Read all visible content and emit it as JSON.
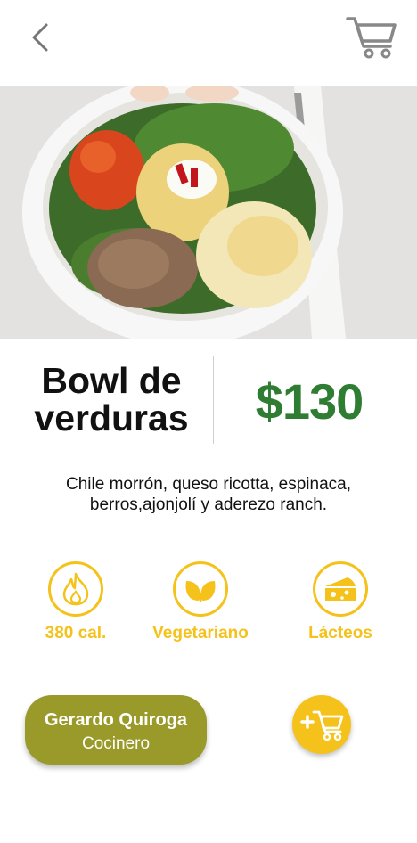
{
  "header": {
    "back_icon": "chevron-left-icon",
    "cart_icon": "cart-icon"
  },
  "dish": {
    "name": "Bowl de verduras",
    "price": "$130",
    "description": "Chile morrón, queso ricotta, espinaca, berros,ajonjolí y aderezo ranch."
  },
  "attributes": [
    {
      "icon": "flame-icon",
      "label": "380 cal."
    },
    {
      "icon": "leaf-icon",
      "label": "Vegetariano"
    },
    {
      "icon": "cheese-icon",
      "label": "Lácteos"
    }
  ],
  "chef": {
    "name": "Gerardo Quiroga",
    "role": "Cocinero"
  },
  "actions": {
    "add_to_cart_icon": "add-to-cart-icon"
  },
  "colors": {
    "accent_yellow": "#f4c21a",
    "price_green": "#2e7d32",
    "chef_olive": "#9a9a2a"
  }
}
